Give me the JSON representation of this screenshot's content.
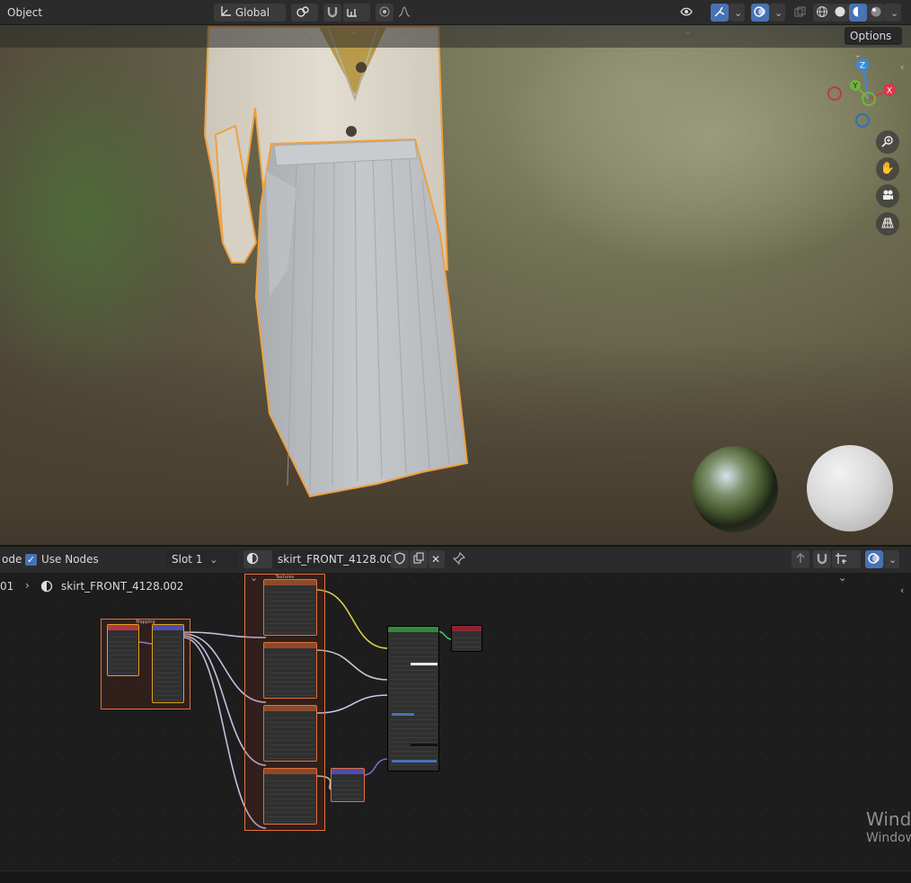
{
  "viewport": {
    "mode_label": "Object",
    "transform_orientation": "Global",
    "options_label": "Options",
    "gizmo_axes": {
      "z": "Z",
      "y": "Y",
      "x": "X"
    }
  },
  "node_editor": {
    "mode_label_partial": "ode",
    "use_nodes_label": "Use Nodes",
    "slot_label": "Slot 1",
    "material_name": "skirt_FRONT_4128.002",
    "breadcrumb_prefix": "01",
    "breadcrumb_material": "skirt_FRONT_4128.002",
    "frames": {
      "mapping_label": "Mapping",
      "textures_label": "Textures"
    }
  },
  "watermark": {
    "line1": "Windo",
    "line2": "Window"
  },
  "colors": {
    "accent_blue": "#4772b3",
    "frame_orange": "#e2713a",
    "outline_orange": "#f0a040"
  }
}
